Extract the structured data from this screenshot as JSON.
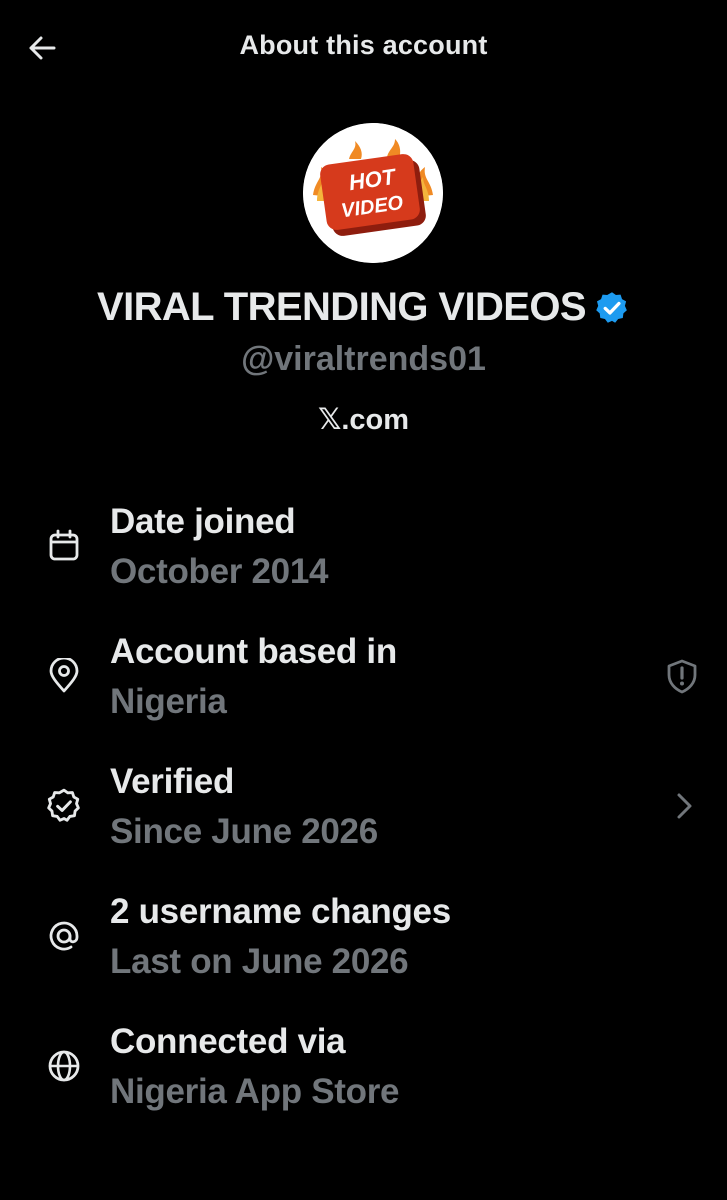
{
  "header": {
    "title": "About this account"
  },
  "profile": {
    "avatar_text_line1": "HOT",
    "avatar_text_line2": "VIDEO",
    "display_name": "VIRAL TRENDING VIDEOS",
    "handle": "@viraltrends01",
    "site_glyph": "𝕏",
    "site_suffix": ".com",
    "verified": true
  },
  "rows": [
    {
      "icon": "calendar-icon",
      "title": "Date joined",
      "subtitle": "October 2014"
    },
    {
      "icon": "location-pin-icon",
      "title": "Account based in",
      "subtitle": "Nigeria",
      "trailing_icon": "shield-alert-icon"
    },
    {
      "icon": "verified-badge-icon",
      "title": "Verified",
      "subtitle": "Since June 2026",
      "trailing_icon": "chevron-right-icon"
    },
    {
      "icon": "at-sign-icon",
      "title": "2 username changes",
      "subtitle": "Last on June 2026"
    },
    {
      "icon": "globe-icon",
      "title": "Connected via",
      "subtitle": "Nigeria App Store"
    }
  ],
  "colors": {
    "background": "#000000",
    "primary_text": "#e7e9ea",
    "secondary_text": "#71767b",
    "verified_blue": "#1d9bf0",
    "avatar_red": "#d63a1c"
  }
}
